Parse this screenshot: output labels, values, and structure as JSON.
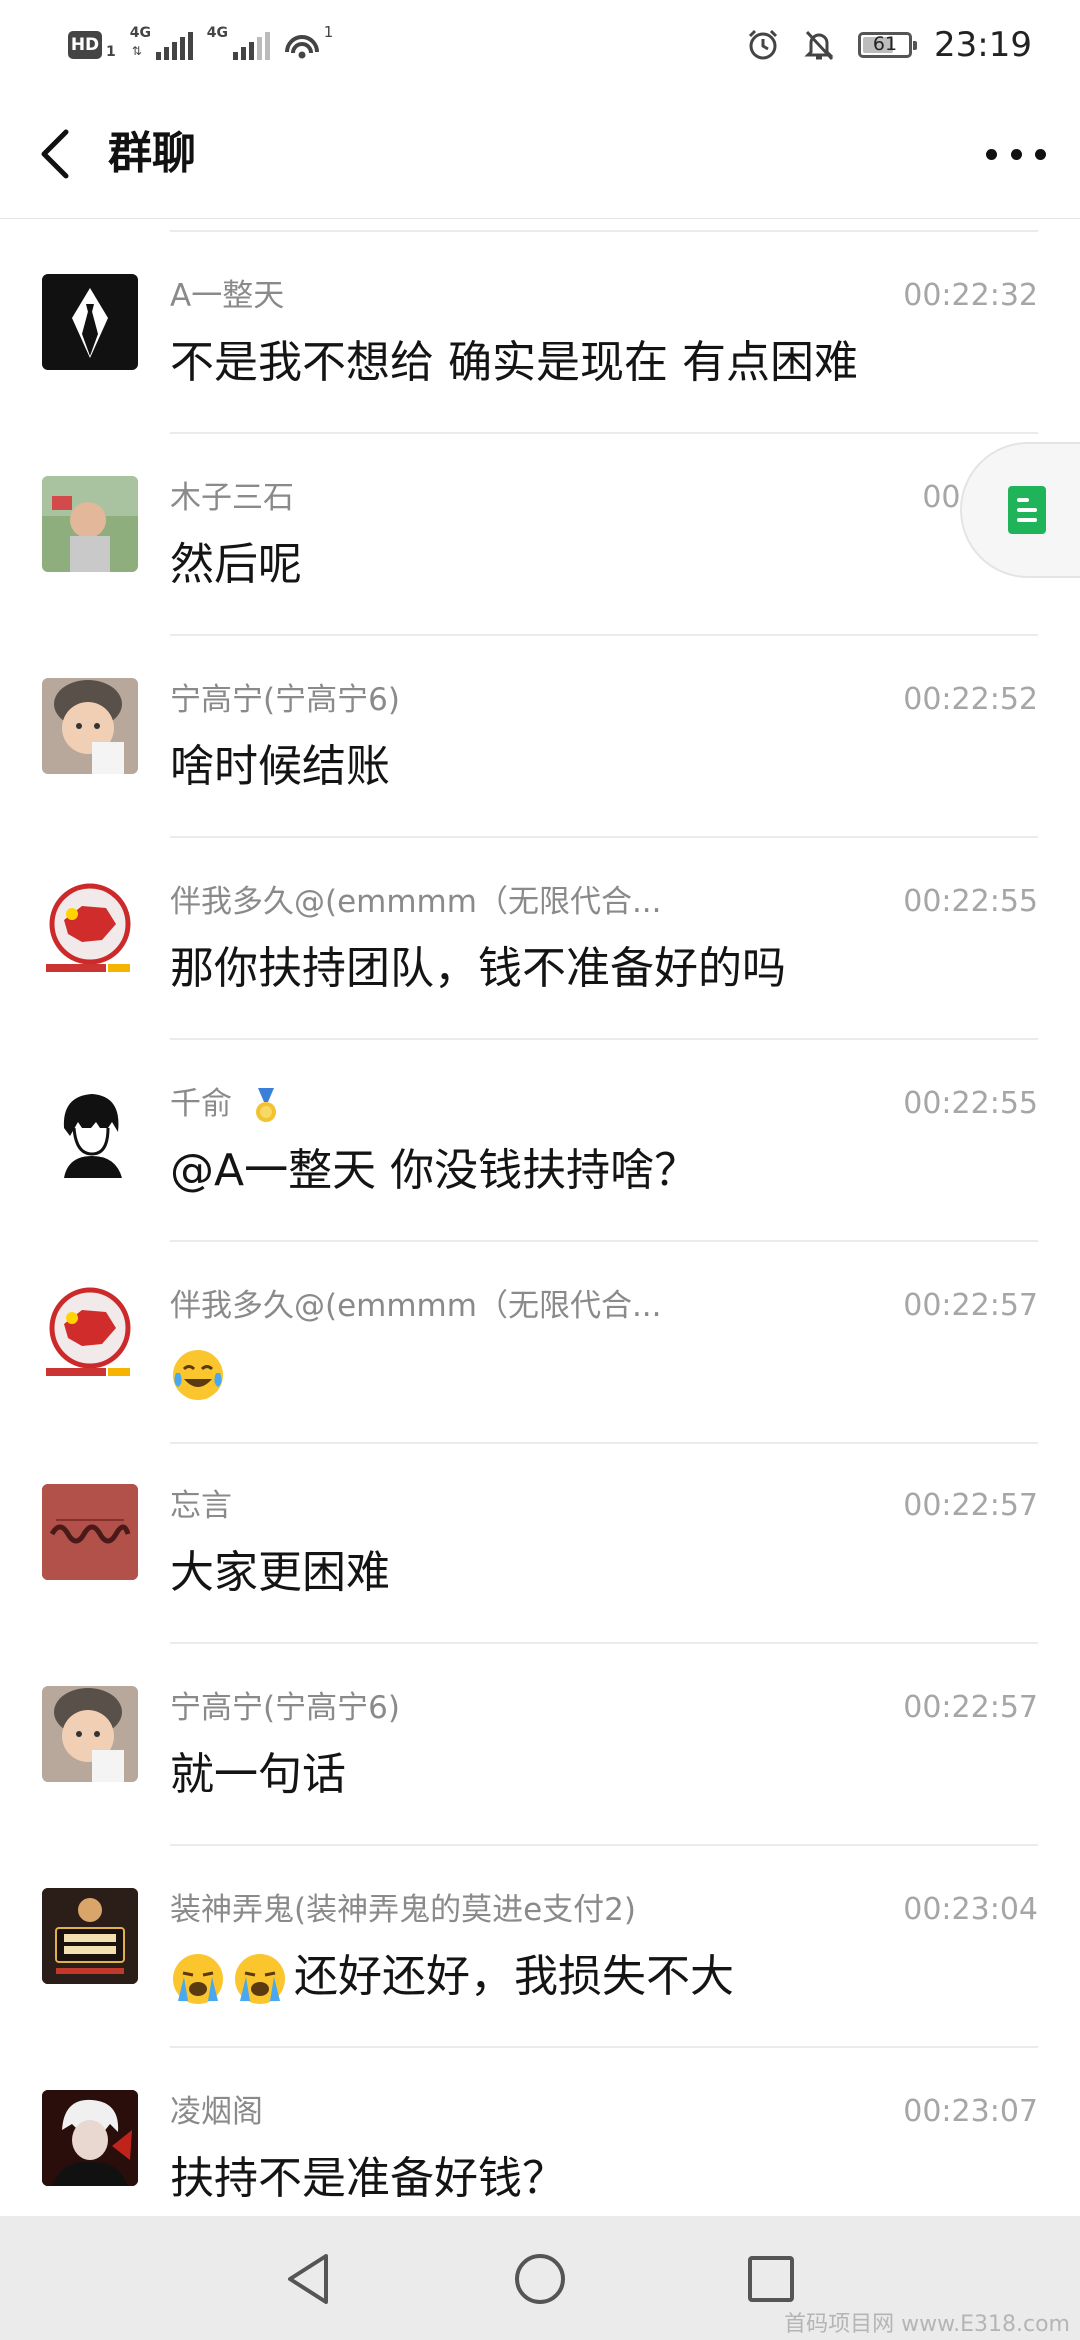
{
  "status_bar": {
    "hd_label": "HD",
    "hd_sub": "1",
    "network_1": "4G",
    "network_2": "4G",
    "wifi_sup": "1",
    "battery": "61",
    "time": "23:19"
  },
  "header": {
    "title": "群聊",
    "back_icon": "chevron-left-icon",
    "more_icon": "more-dots-icon"
  },
  "messages": [
    {
      "sender": "A一整天",
      "time": "00:22:32",
      "text": "不是我不想给  确实是现在 有点困难",
      "avatar_color": "#1a1a1a"
    },
    {
      "sender": "木子三石",
      "time": "00:22:4",
      "text": "然后呢",
      "avatar_color": "#7a9a6a"
    },
    {
      "sender": "宁高宁(宁高宁6)",
      "time": "00:22:52",
      "text": "啥时候结账",
      "avatar_color": "#c9a48a"
    },
    {
      "sender": "伴我多久@(emmmm（无限代合...",
      "time": "00:22:55",
      "text": "那你扶持团队，钱不准备好的吗",
      "avatar_color": "#cc2a2a"
    },
    {
      "sender": "千俞",
      "time": "00:22:55",
      "text": "@A一整天 你没钱扶持啥？",
      "avatar_color": "#2a2a2a"
    },
    {
      "sender": "伴我多久@(emmmm（无限代合...",
      "time": "00:22:57",
      "text": "",
      "avatar_color": "#cc2a2a"
    },
    {
      "sender": "忘言",
      "time": "00:22:57",
      "text": "大家更困难",
      "avatar_color": "#b44a44"
    },
    {
      "sender": "宁高宁(宁高宁6)",
      "time": "00:22:57",
      "text": "就一句话",
      "avatar_color": "#c9a48a"
    },
    {
      "sender": "装神弄鬼(装神弄鬼的莫进e支付2)",
      "time": "00:23:04",
      "text": "还好还好，我损失不大",
      "avatar_color": "#2b1d17"
    },
    {
      "sender": "凌烟阁",
      "time": "00:23:07",
      "text": "扶持不是准备好钱？",
      "avatar_color": "#3a1410"
    }
  ],
  "float_tab_icon": "document-icon",
  "nav": {
    "back_icon": "triangle-back-icon",
    "home_icon": "circle-home-icon",
    "recents_icon": "square-recents-icon",
    "watermark": "首码项目网 www.E318.com"
  }
}
